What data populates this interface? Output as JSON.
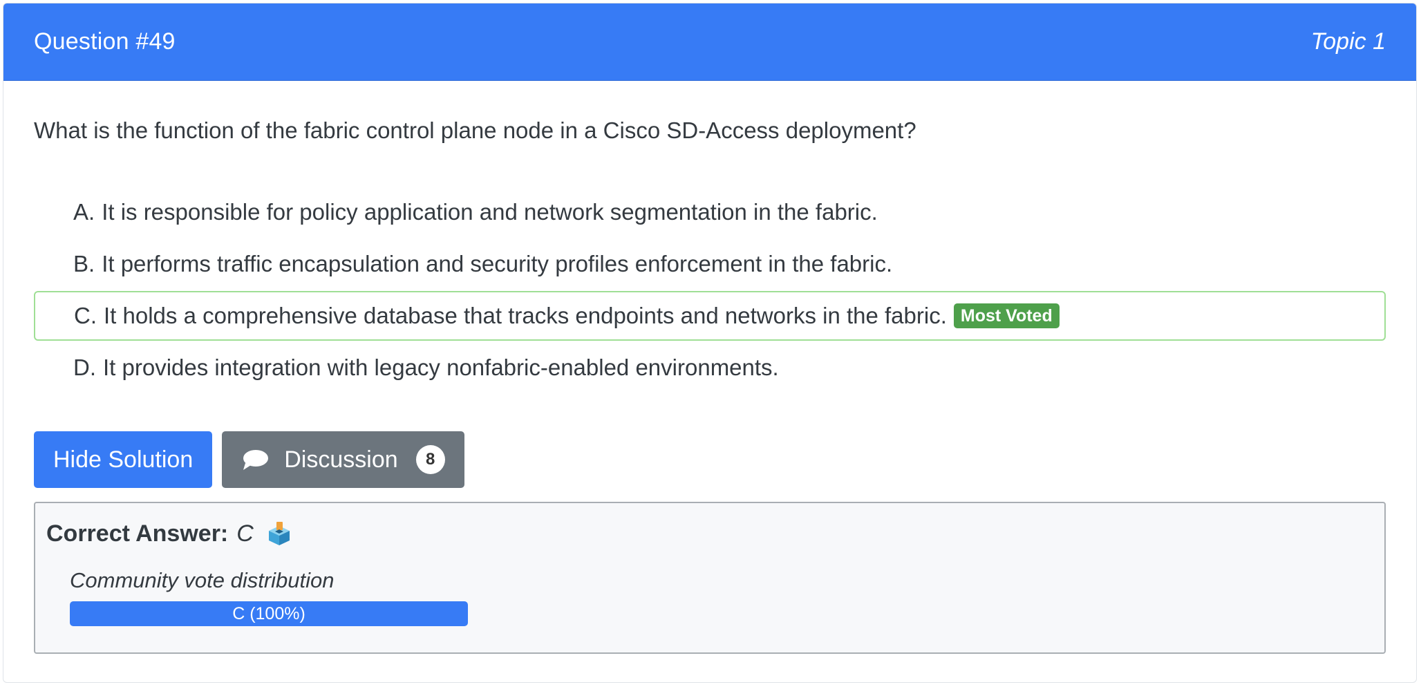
{
  "header": {
    "question_number": "Question #49",
    "topic": "Topic 1"
  },
  "question": {
    "text": "What is the function of the fabric control plane node in a Cisco SD-Access deployment?"
  },
  "choices": [
    {
      "letter": "A.",
      "text": "It is responsible for policy application and network segmentation in the fabric."
    },
    {
      "letter": "B.",
      "text": "It performs traffic encapsulation and security profiles enforcement in the fabric."
    },
    {
      "letter": "C.",
      "text": "It holds a comprehensive database that tracks endpoints and networks in the fabric.",
      "badge": "Most Voted"
    },
    {
      "letter": "D.",
      "text": "It provides integration with legacy nonfabric-enabled environments."
    }
  ],
  "actions": {
    "hide_solution_label": "Hide Solution",
    "discussion_label": "Discussion",
    "discussion_count": "8"
  },
  "answer": {
    "label": "Correct Answer:",
    "value": "C",
    "icon": "ballot-box-icon"
  },
  "vote_distribution": {
    "title": "Community vote distribution",
    "bars": [
      {
        "label": "C (100%)",
        "fraction": 1.0
      }
    ]
  },
  "colors": {
    "primary": "#377bf5",
    "secondary": "#6c757d",
    "success": "#4ea04b",
    "correct_border": "#9fdf95"
  }
}
